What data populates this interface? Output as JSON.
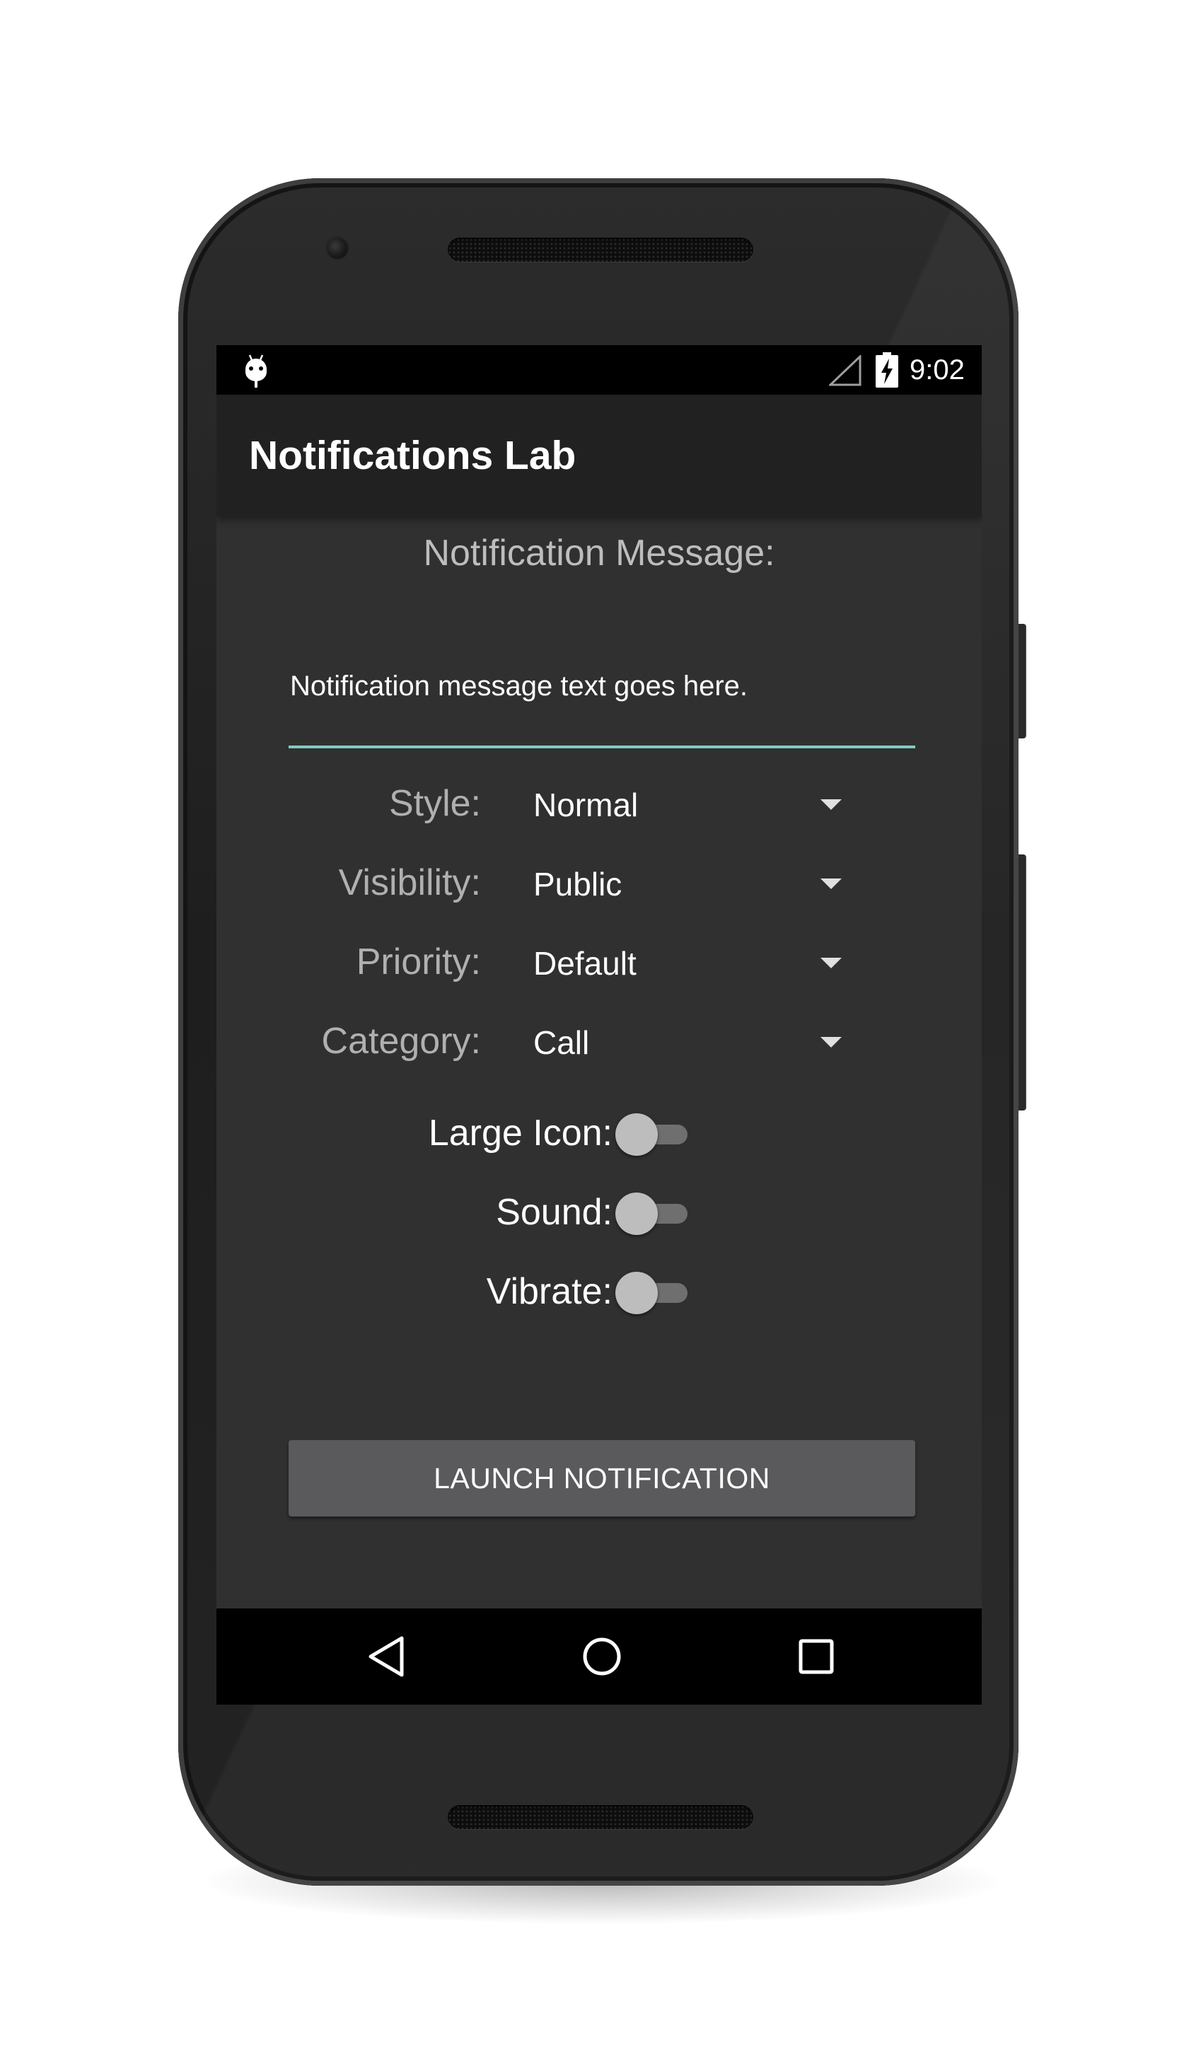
{
  "status_bar": {
    "time": "9:02",
    "icons": [
      "android-notification-icon",
      "signal-icon",
      "battery-charging-icon"
    ]
  },
  "app_bar": {
    "title": "Notifications Lab"
  },
  "message": {
    "heading": "Notification Message:",
    "value": "Notification message text goes here.",
    "accent_color": "#80cbc4"
  },
  "spinners": [
    {
      "label": "Style:",
      "value": "Normal"
    },
    {
      "label": "Visibility:",
      "value": "Public"
    },
    {
      "label": "Priority:",
      "value": "Default"
    },
    {
      "label": "Category:",
      "value": "Call"
    }
  ],
  "switches": [
    {
      "label": "Large Icon:",
      "checked": false
    },
    {
      "label": "Sound:",
      "checked": false
    },
    {
      "label": "Vibrate:",
      "checked": false
    }
  ],
  "launch_button": {
    "label": "LAUNCH NOTIFICATION"
  },
  "nav_bar": {
    "icons": [
      "back-icon",
      "home-icon",
      "recents-icon"
    ]
  },
  "colors": {
    "screen_background": "#303030",
    "app_bar_background": "#212121",
    "button_background": "#5a5a5c"
  }
}
